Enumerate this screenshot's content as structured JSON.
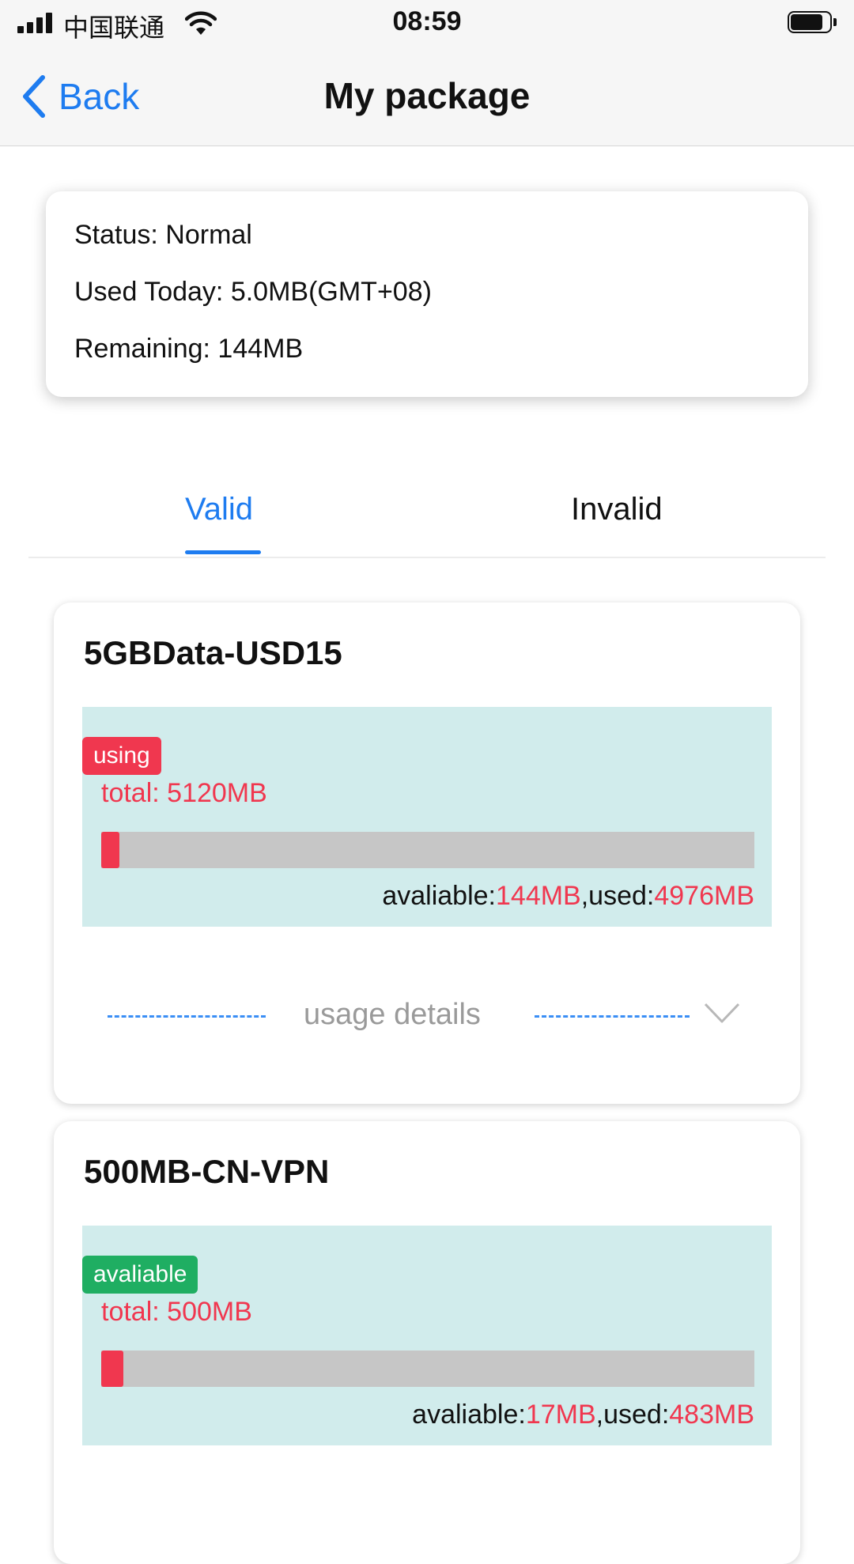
{
  "status_bar": {
    "carrier": "中国联通",
    "time": "08:59"
  },
  "nav": {
    "back_label": "Back",
    "title": "My package"
  },
  "summary": {
    "status": "Status: Normal",
    "used_today": "Used Today: 5.0MB(GMT+08)",
    "remaining": "Remaining: 144MB"
  },
  "tabs": [
    {
      "label": "Valid",
      "active": true
    },
    {
      "label": "Invalid",
      "active": false
    }
  ],
  "packages": [
    {
      "name": "5GBData-USD15",
      "badge": "using",
      "badge_color": "#f0374f",
      "total": "total: 5120MB",
      "available_prefix": "avaliable:",
      "available_value": "144MB",
      "used_prefix": ",used:",
      "used_value": "4976MB",
      "usage_fraction": 0.028,
      "details_label": "usage details"
    },
    {
      "name": "500MB-CN-VPN",
      "badge": "avaliable",
      "badge_color": "#1fae62",
      "total": "total: 500MB",
      "available_prefix": "avaliable:",
      "available_value": "17MB",
      "used_prefix": ",used:",
      "used_value": "483MB",
      "usage_fraction": 0.034
    }
  ],
  "colors": {
    "accent_blue": "#1e7cf0",
    "alert_red": "#f0374f",
    "panel_bg": "#d1ecec"
  }
}
